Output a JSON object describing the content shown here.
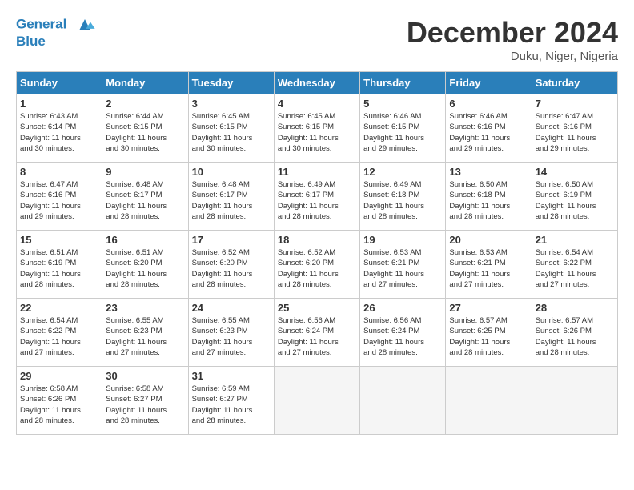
{
  "header": {
    "logo_line1": "General",
    "logo_line2": "Blue",
    "month_title": "December 2024",
    "location": "Duku, Niger, Nigeria"
  },
  "weekdays": [
    "Sunday",
    "Monday",
    "Tuesday",
    "Wednesday",
    "Thursday",
    "Friday",
    "Saturday"
  ],
  "weeks": [
    [
      {
        "day": "1",
        "info": "Sunrise: 6:43 AM\nSunset: 6:14 PM\nDaylight: 11 hours\nand 30 minutes."
      },
      {
        "day": "2",
        "info": "Sunrise: 6:44 AM\nSunset: 6:15 PM\nDaylight: 11 hours\nand 30 minutes."
      },
      {
        "day": "3",
        "info": "Sunrise: 6:45 AM\nSunset: 6:15 PM\nDaylight: 11 hours\nand 30 minutes."
      },
      {
        "day": "4",
        "info": "Sunrise: 6:45 AM\nSunset: 6:15 PM\nDaylight: 11 hours\nand 30 minutes."
      },
      {
        "day": "5",
        "info": "Sunrise: 6:46 AM\nSunset: 6:15 PM\nDaylight: 11 hours\nand 29 minutes."
      },
      {
        "day": "6",
        "info": "Sunrise: 6:46 AM\nSunset: 6:16 PM\nDaylight: 11 hours\nand 29 minutes."
      },
      {
        "day": "7",
        "info": "Sunrise: 6:47 AM\nSunset: 6:16 PM\nDaylight: 11 hours\nand 29 minutes."
      }
    ],
    [
      {
        "day": "8",
        "info": "Sunrise: 6:47 AM\nSunset: 6:16 PM\nDaylight: 11 hours\nand 29 minutes."
      },
      {
        "day": "9",
        "info": "Sunrise: 6:48 AM\nSunset: 6:17 PM\nDaylight: 11 hours\nand 28 minutes."
      },
      {
        "day": "10",
        "info": "Sunrise: 6:48 AM\nSunset: 6:17 PM\nDaylight: 11 hours\nand 28 minutes."
      },
      {
        "day": "11",
        "info": "Sunrise: 6:49 AM\nSunset: 6:17 PM\nDaylight: 11 hours\nand 28 minutes."
      },
      {
        "day": "12",
        "info": "Sunrise: 6:49 AM\nSunset: 6:18 PM\nDaylight: 11 hours\nand 28 minutes."
      },
      {
        "day": "13",
        "info": "Sunrise: 6:50 AM\nSunset: 6:18 PM\nDaylight: 11 hours\nand 28 minutes."
      },
      {
        "day": "14",
        "info": "Sunrise: 6:50 AM\nSunset: 6:19 PM\nDaylight: 11 hours\nand 28 minutes."
      }
    ],
    [
      {
        "day": "15",
        "info": "Sunrise: 6:51 AM\nSunset: 6:19 PM\nDaylight: 11 hours\nand 28 minutes."
      },
      {
        "day": "16",
        "info": "Sunrise: 6:51 AM\nSunset: 6:20 PM\nDaylight: 11 hours\nand 28 minutes."
      },
      {
        "day": "17",
        "info": "Sunrise: 6:52 AM\nSunset: 6:20 PM\nDaylight: 11 hours\nand 28 minutes."
      },
      {
        "day": "18",
        "info": "Sunrise: 6:52 AM\nSunset: 6:20 PM\nDaylight: 11 hours\nand 28 minutes."
      },
      {
        "day": "19",
        "info": "Sunrise: 6:53 AM\nSunset: 6:21 PM\nDaylight: 11 hours\nand 27 minutes."
      },
      {
        "day": "20",
        "info": "Sunrise: 6:53 AM\nSunset: 6:21 PM\nDaylight: 11 hours\nand 27 minutes."
      },
      {
        "day": "21",
        "info": "Sunrise: 6:54 AM\nSunset: 6:22 PM\nDaylight: 11 hours\nand 27 minutes."
      }
    ],
    [
      {
        "day": "22",
        "info": "Sunrise: 6:54 AM\nSunset: 6:22 PM\nDaylight: 11 hours\nand 27 minutes."
      },
      {
        "day": "23",
        "info": "Sunrise: 6:55 AM\nSunset: 6:23 PM\nDaylight: 11 hours\nand 27 minutes."
      },
      {
        "day": "24",
        "info": "Sunrise: 6:55 AM\nSunset: 6:23 PM\nDaylight: 11 hours\nand 27 minutes."
      },
      {
        "day": "25",
        "info": "Sunrise: 6:56 AM\nSunset: 6:24 PM\nDaylight: 11 hours\nand 27 minutes."
      },
      {
        "day": "26",
        "info": "Sunrise: 6:56 AM\nSunset: 6:24 PM\nDaylight: 11 hours\nand 28 minutes."
      },
      {
        "day": "27",
        "info": "Sunrise: 6:57 AM\nSunset: 6:25 PM\nDaylight: 11 hours\nand 28 minutes."
      },
      {
        "day": "28",
        "info": "Sunrise: 6:57 AM\nSunset: 6:26 PM\nDaylight: 11 hours\nand 28 minutes."
      }
    ],
    [
      {
        "day": "29",
        "info": "Sunrise: 6:58 AM\nSunset: 6:26 PM\nDaylight: 11 hours\nand 28 minutes."
      },
      {
        "day": "30",
        "info": "Sunrise: 6:58 AM\nSunset: 6:27 PM\nDaylight: 11 hours\nand 28 minutes."
      },
      {
        "day": "31",
        "info": "Sunrise: 6:59 AM\nSunset: 6:27 PM\nDaylight: 11 hours\nand 28 minutes."
      },
      null,
      null,
      null,
      null
    ]
  ]
}
